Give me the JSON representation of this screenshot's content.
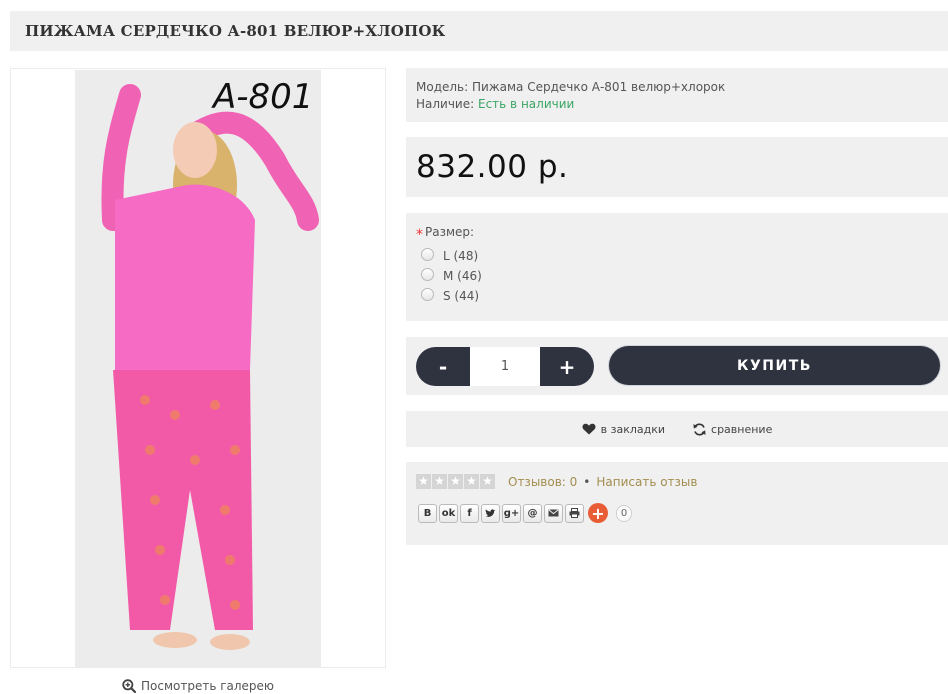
{
  "product": {
    "title": "ПИЖАМА СЕРДЕЧКО А-801 ВЕЛЮР+ХЛОПОК",
    "image_label": "A-801",
    "gallery_link": "Посмотреть галерею"
  },
  "info": {
    "model_label": "Модель:",
    "model_value": "Пижама Сердечко А-801 велюр+хлорок",
    "stock_label": "Наличие:",
    "stock_value": "Есть в наличии",
    "stock_color": "#3aa564"
  },
  "price": "832.00 р.",
  "options": {
    "required_mark": "*",
    "size_label": "Размер:",
    "sizes": [
      "L (48)",
      "M (46)",
      "S (44)"
    ]
  },
  "purchase": {
    "minus_label": "-",
    "plus_label": "+",
    "quantity": "1",
    "buy_label": "КУПИТЬ",
    "button_color": "#2f3340"
  },
  "actions": {
    "bookmark_label": "в закладки",
    "compare_label": "сравнение"
  },
  "review": {
    "rating": 0,
    "max_rating": 5,
    "reviews_text": "Отзывов: 0",
    "separator": "•",
    "write_review": "Написать отзыв",
    "share_buttons": [
      "vk-icon",
      "odnoklassniki-icon",
      "facebook-icon",
      "twitter-icon",
      "google-plus-icon",
      "mail-ru-icon",
      "email-icon",
      "print-icon"
    ],
    "share_plus": "+",
    "share_count": "0"
  }
}
